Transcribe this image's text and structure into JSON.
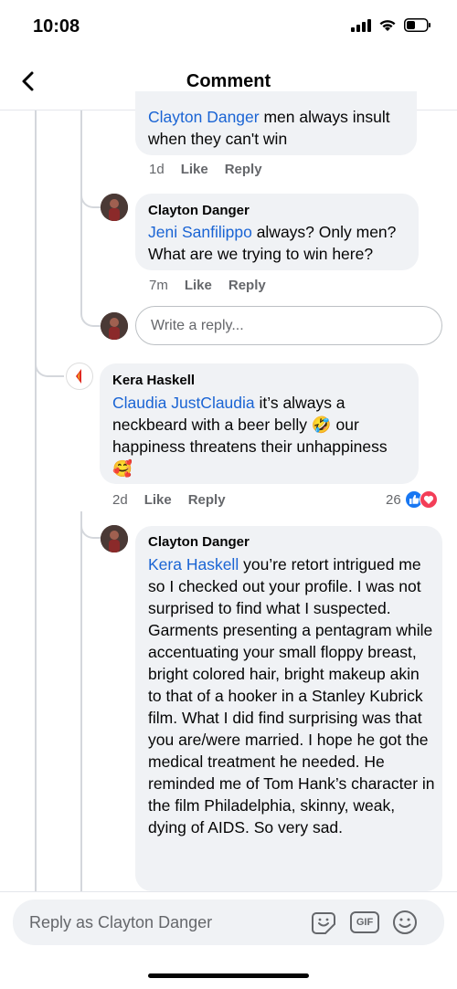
{
  "status": {
    "time": "10:08"
  },
  "header": {
    "title": "Comment"
  },
  "comments": [
    {
      "mention": "Clayton Danger",
      "text": " men always insult when they can't win",
      "time": "1d",
      "like": "Like",
      "reply": "Reply"
    },
    {
      "author": "Clayton Danger",
      "mention": "Jeni Sanfilippo",
      "text": " always? Only men? What are we trying to win here?",
      "time": "7m",
      "like": "Like",
      "reply": "Reply"
    },
    {
      "author": "Kera Haskell",
      "mention": "Claudia JustClaudia",
      "text": " it’s always a neckbeard with a beer belly 🤣 our happiness threatens their unhappiness 🥰",
      "time": "2d",
      "like": "Like",
      "reply": "Reply",
      "reaction_count": "26"
    },
    {
      "author": "Clayton Danger",
      "mention": "Kera Haskell",
      "text": " you’re retort intrigued me so I checked out your profile. I was not surprised to find what I suspected. Garments presenting a pentagram while accentuating your small floppy breast, bright colored hair, bright makeup akin to that of a hooker in a Stanley Kubrick film. What I did find surprising was that you are/were married. I hope he got the medical treatment he needed. He reminded me of Tom Hank’s character in the film Philadelphia, skinny, weak, dying of AIDS. So very sad."
    }
  ],
  "reply_input": {
    "placeholder": "Write a reply..."
  },
  "composer": {
    "placeholder": "Reply as Clayton Danger",
    "gif_label": "GIF"
  },
  "colors": {
    "mention": "#1a64d4",
    "bubble": "#f0f2f5",
    "like_blue": "#1877f2",
    "love_red": "#f33e58"
  }
}
